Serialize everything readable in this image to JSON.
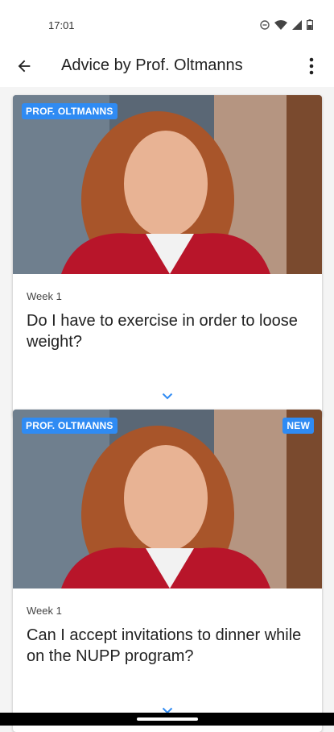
{
  "status_bar": {
    "time": "17:01",
    "icons": [
      "dnd-icon",
      "wifi-icon",
      "signal-icon",
      "battery-icon"
    ]
  },
  "app_bar": {
    "title": "Advice by Prof. Oltmanns",
    "back_icon": "arrow-left-icon",
    "menu_icon": "more-vertical-icon"
  },
  "cards": [
    {
      "badge": "PROF. OLTMANNS",
      "new_badge": "",
      "week": "Week 1",
      "question": "Do I have to exercise in order to loose weight?"
    },
    {
      "badge": "PROF. OLTMANNS",
      "new_badge": "NEW",
      "week": "Week 1",
      "question": "Can I accept invitations to dinner while on the NUPP program?"
    }
  ],
  "colors": {
    "accent": "#2f8bf3",
    "background": "#f4f4f4",
    "card": "#ffffff"
  }
}
